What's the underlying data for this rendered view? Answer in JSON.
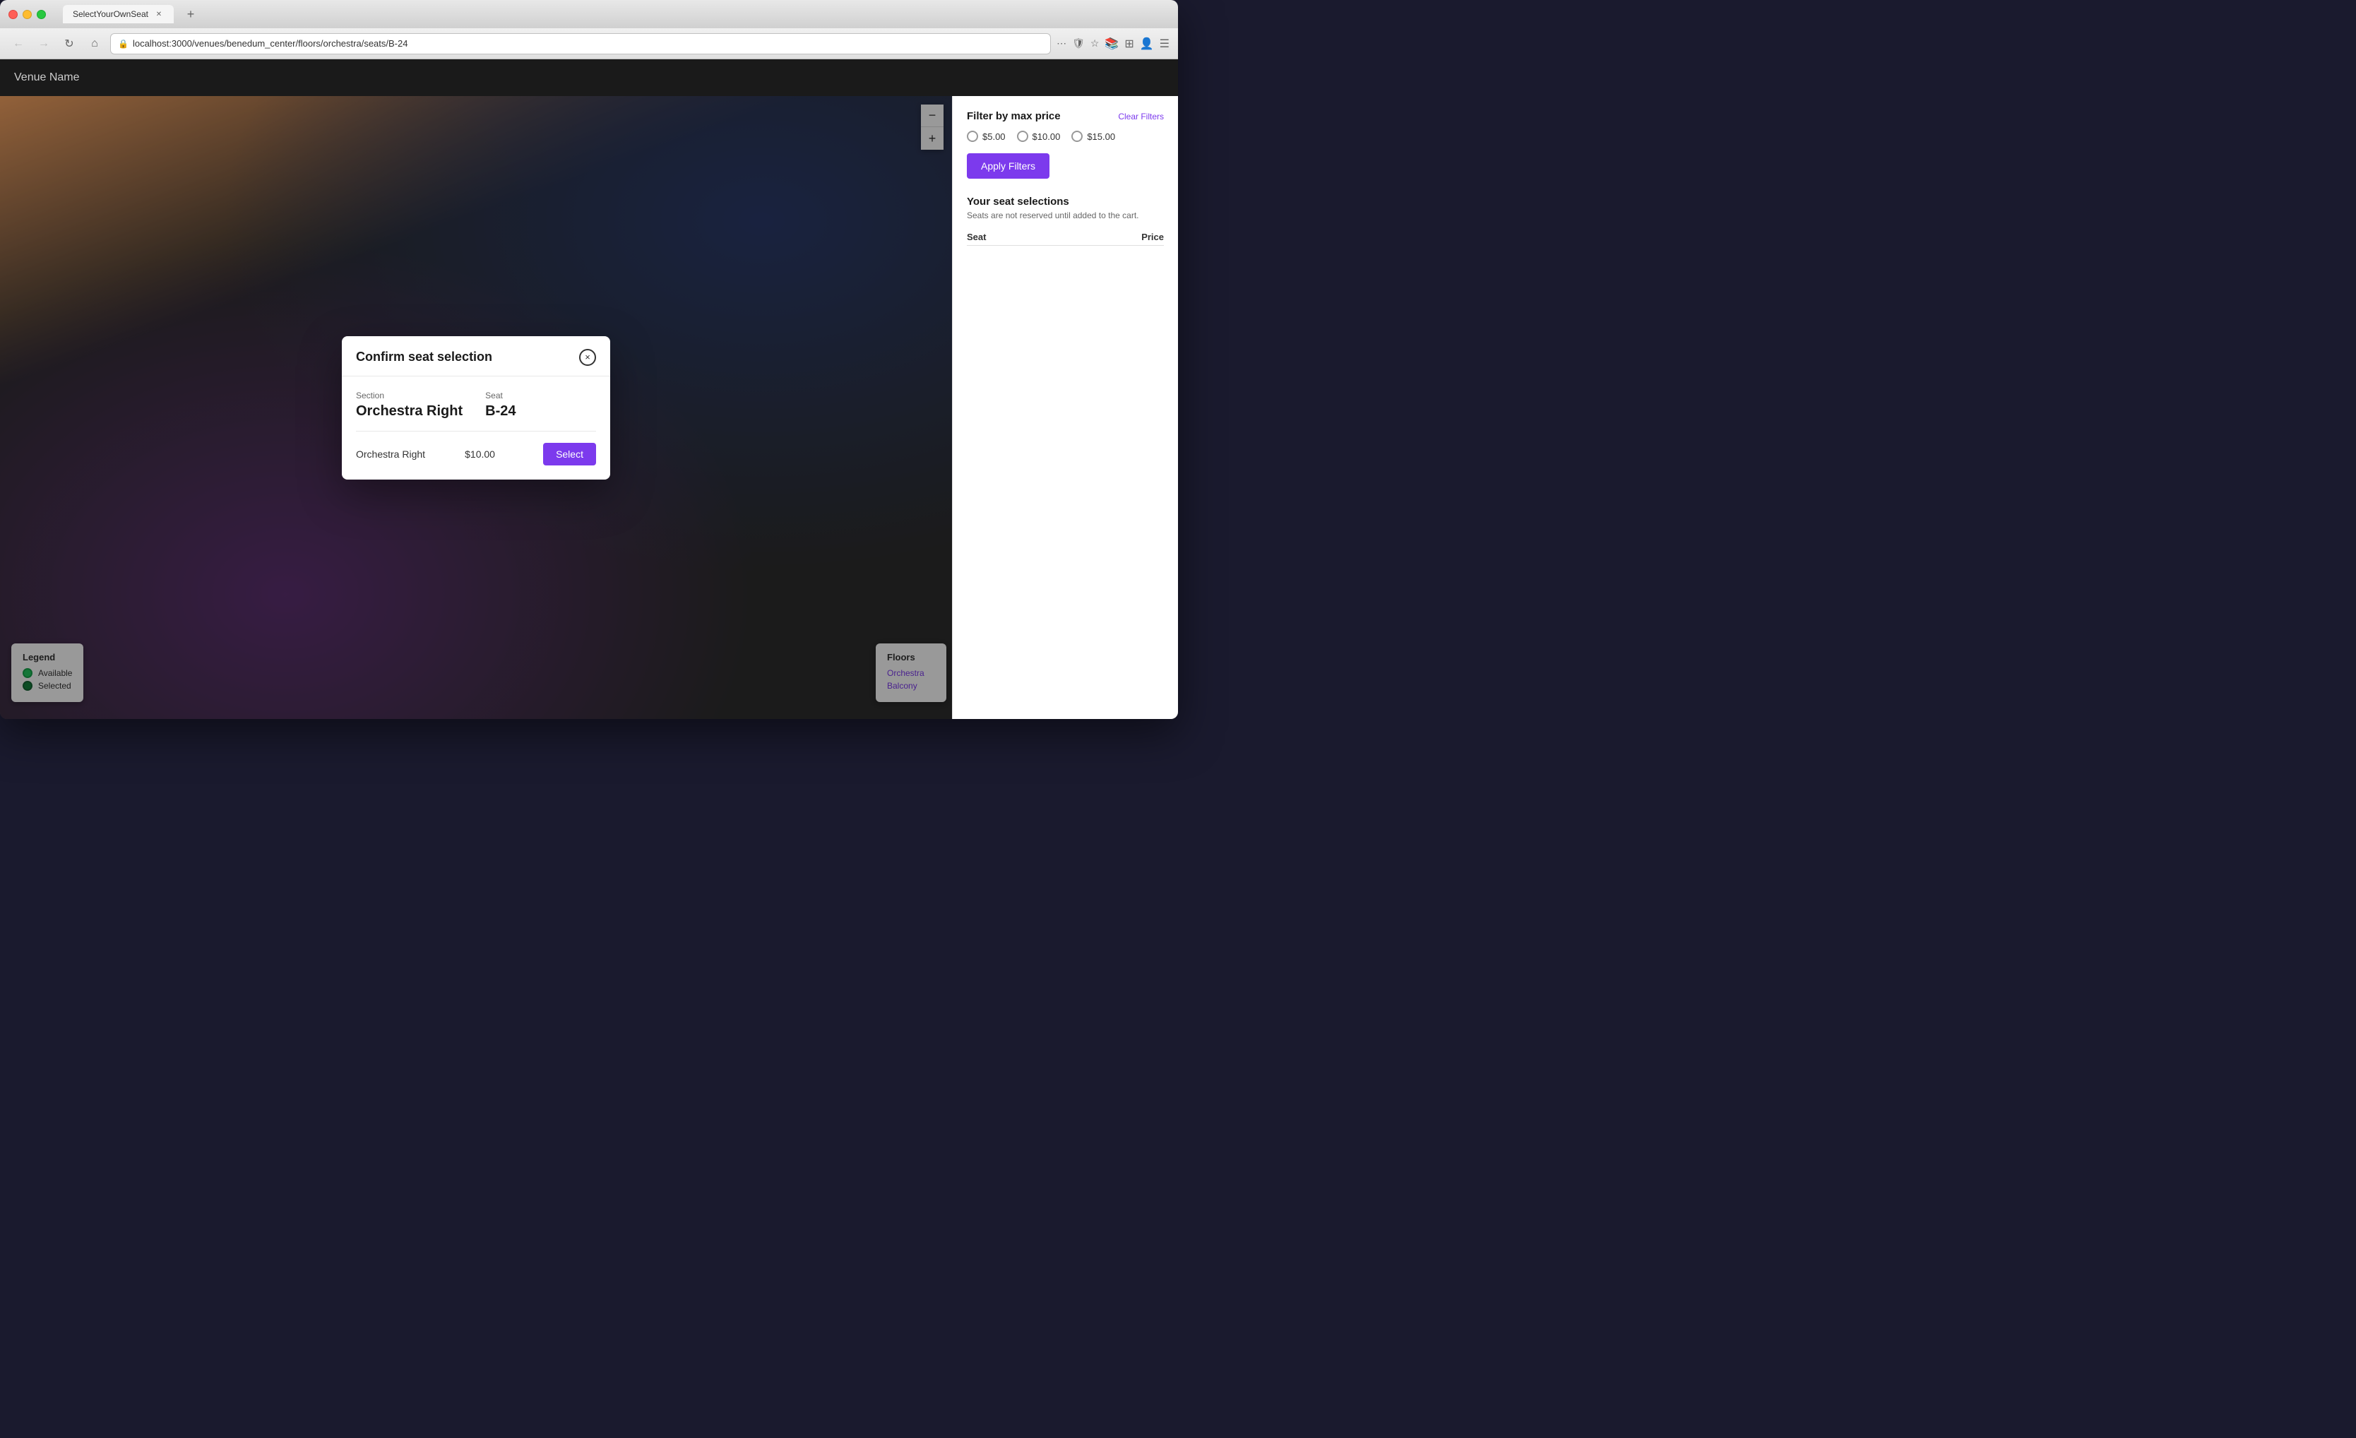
{
  "browser": {
    "tab_title": "SelectYourOwnSeat",
    "url": "localhost:3000/venues/benedum_center/floors/orchestra/seats/B-24",
    "new_tab_label": "+"
  },
  "app": {
    "venue_name": "Venue Name"
  },
  "zoom": {
    "minus": "−",
    "plus": "+"
  },
  "filter": {
    "title": "Filter by max price",
    "clear_label": "Clear Filters",
    "prices": [
      {
        "label": "$5.00",
        "value": "5"
      },
      {
        "label": "$10.00",
        "value": "10"
      },
      {
        "label": "$15.00",
        "value": "15"
      }
    ],
    "apply_label": "Apply Filters"
  },
  "seat_selections": {
    "title": "Your seat selections",
    "subtitle": "Seats are not reserved until added to the cart.",
    "col_seat": "Seat",
    "col_price": "Price"
  },
  "legend": {
    "title": "Legend",
    "items": [
      {
        "key": "available",
        "label": "Available"
      },
      {
        "key": "selected",
        "label": "Selected"
      }
    ]
  },
  "floors": {
    "title": "Floors",
    "items": [
      {
        "label": "Orchestra",
        "url": "#"
      },
      {
        "label": "Balcony",
        "url": "#"
      }
    ]
  },
  "modal": {
    "title": "Confirm seat selection",
    "close_icon": "×",
    "section_label": "Section",
    "section_value": "Orchestra Right",
    "seat_label": "Seat",
    "seat_value": "B-24",
    "row_section": "Orchestra Right",
    "row_price": "$10.00",
    "select_label": "Select"
  }
}
